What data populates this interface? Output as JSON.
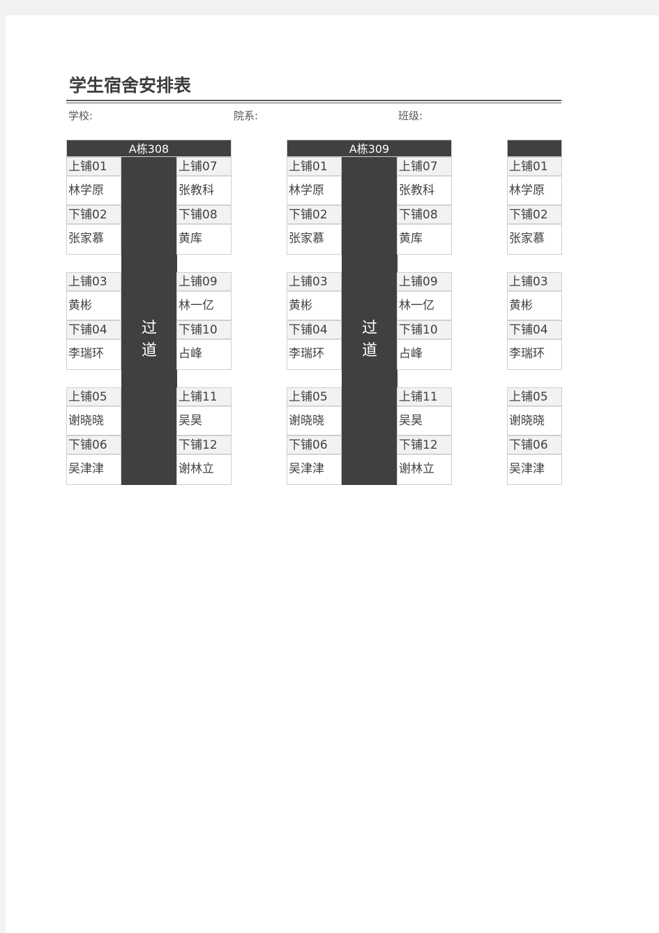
{
  "title": "学生宿舍安排表",
  "info": {
    "school_label": "学校:",
    "department_label": "院系:",
    "class_label": "班级:"
  },
  "aisle_label_line1": "过",
  "aisle_label_line2": "道",
  "rooms": [
    {
      "name": "A栋308",
      "beds": [
        {
          "label": "上铺01",
          "name": "林学原"
        },
        {
          "label": "下铺02",
          "name": "张家慕"
        },
        {
          "label": "上铺03",
          "name": "黄彬"
        },
        {
          "label": "下铺04",
          "name": "李瑞环"
        },
        {
          "label": "上铺05",
          "name": "谢晓晓"
        },
        {
          "label": "下铺06",
          "name": "吴津津"
        },
        {
          "label": "上铺07",
          "name": "张教科"
        },
        {
          "label": "下铺08",
          "name": "黄库"
        },
        {
          "label": "上铺09",
          "name": "林一亿"
        },
        {
          "label": "下铺10",
          "name": "占峰"
        },
        {
          "label": "上铺11",
          "name": "吴昊"
        },
        {
          "label": "下铺12",
          "name": "谢林立"
        }
      ]
    },
    {
      "name": "A栋309",
      "beds": [
        {
          "label": "上铺01",
          "name": "林学原"
        },
        {
          "label": "下铺02",
          "name": "张家慕"
        },
        {
          "label": "上铺03",
          "name": "黄彬"
        },
        {
          "label": "下铺04",
          "name": "李瑞环"
        },
        {
          "label": "上铺05",
          "name": "谢晓晓"
        },
        {
          "label": "下铺06",
          "name": "吴津津"
        },
        {
          "label": "上铺07",
          "name": "张教科"
        },
        {
          "label": "下铺08",
          "name": "黄库"
        },
        {
          "label": "上铺09",
          "name": "林一亿"
        },
        {
          "label": "下铺10",
          "name": "占峰"
        },
        {
          "label": "上铺11",
          "name": "吴昊"
        },
        {
          "label": "下铺12",
          "name": "谢林立"
        }
      ]
    },
    {
      "name": "",
      "beds": [
        {
          "label": "上铺01",
          "name": "林学原"
        },
        {
          "label": "下铺02",
          "name": "张家慕"
        },
        {
          "label": "上铺03",
          "name": "黄彬"
        },
        {
          "label": "下铺04",
          "name": "李瑞环"
        },
        {
          "label": "上铺05",
          "name": "谢晓晓"
        },
        {
          "label": "下铺06",
          "name": "吴津津"
        }
      ]
    }
  ]
}
